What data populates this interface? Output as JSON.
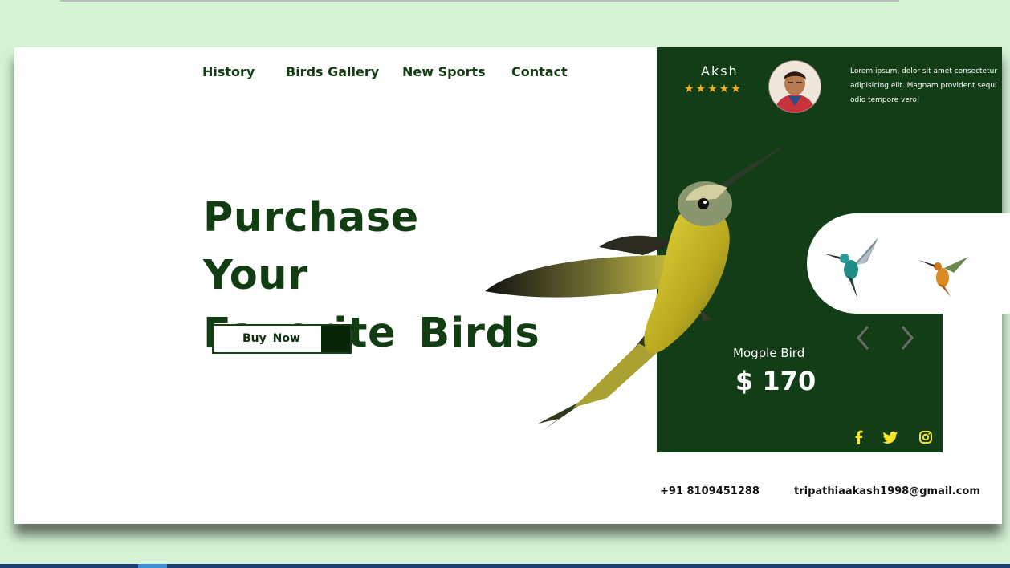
{
  "nav": {
    "items": [
      "History",
      "Birds Gallery",
      "New Sports",
      "Contact"
    ]
  },
  "hero": {
    "headline_line1": "Purchase  Your",
    "headline_line2": "Favorite  Birds",
    "buy_label": "Buy  Now"
  },
  "profile": {
    "name": "Aksh",
    "rating_stars": "★★★★★",
    "rating": 5,
    "blurb": "Lorem ipsum, dolor sit amet consectetur adipisicing elit. Magnam provident sequi odio tempore vero!"
  },
  "product": {
    "name": "Mogple Bird",
    "price": "$ 170"
  },
  "contact": {
    "phone": "+91 8109451288",
    "email": "tripathiaakash1998@gmail.com"
  },
  "icons": [
    "chevron-left-icon",
    "chevron-right-icon",
    "facebook-icon",
    "twitter-icon",
    "instagram-icon",
    "hummingbird-image",
    "avatar-photo"
  ],
  "colors": {
    "brand_green": "#123d16",
    "star": "#f4b01c",
    "social_icon": "#f5e72a",
    "page_bg": "#d6f3d6"
  }
}
